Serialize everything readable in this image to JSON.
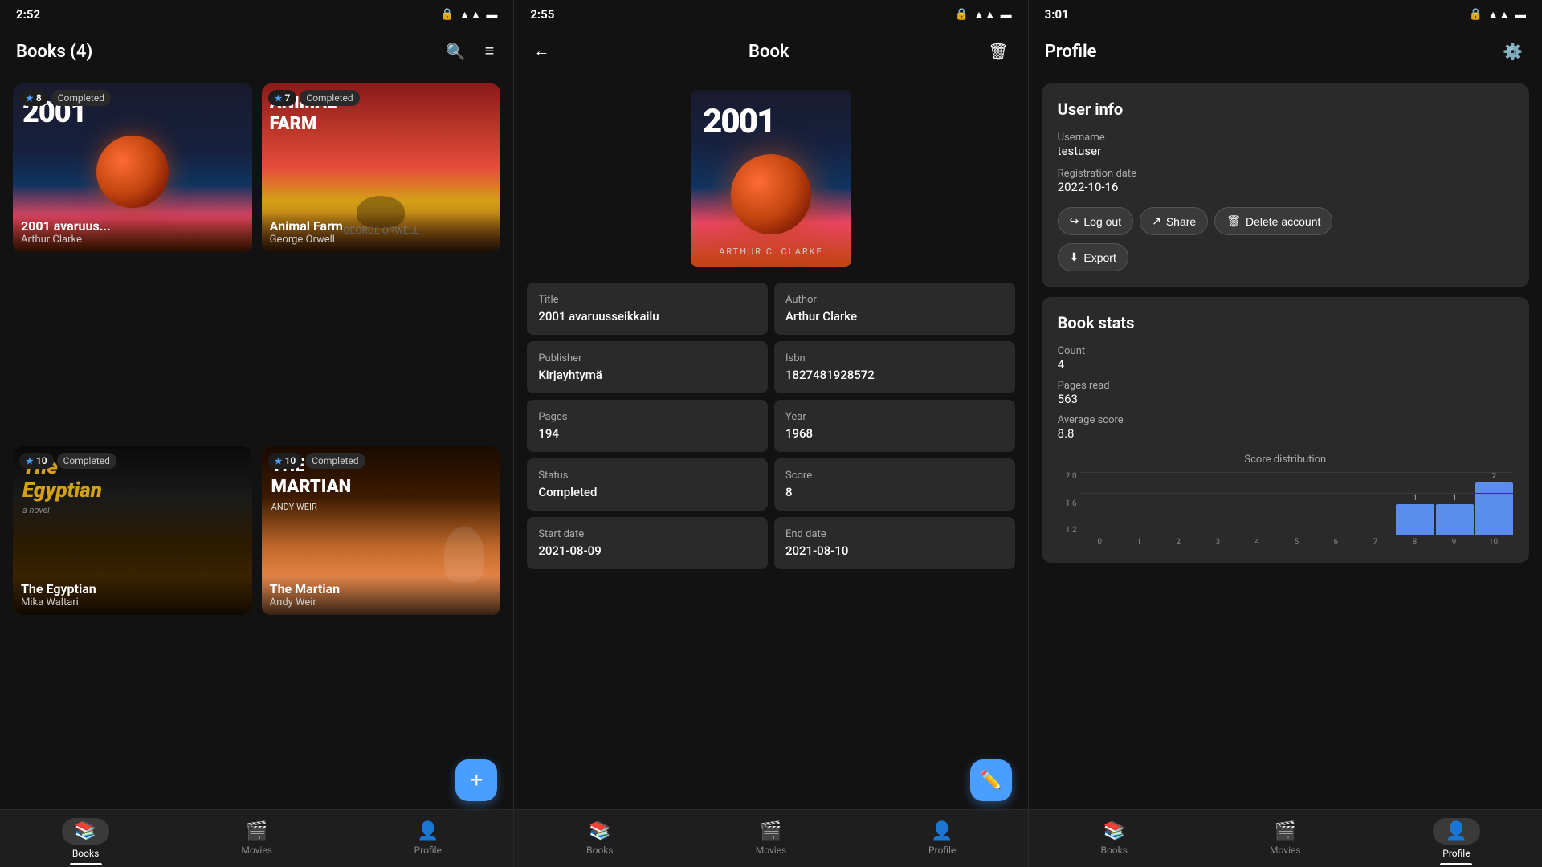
{
  "panels": {
    "books": {
      "status_bar": {
        "time": "2:52",
        "icons": [
          "sim",
          "wifi",
          "battery"
        ]
      },
      "title": "Books (4)",
      "actions": [
        "search",
        "filter"
      ],
      "books": [
        {
          "id": "2001",
          "title": "2001 avaruus...",
          "author": "Arthur Clarke",
          "rating": "8",
          "status": "Completed",
          "cover_type": "2001"
        },
        {
          "id": "animal-farm",
          "title": "Animal Farm",
          "author": "George Orwell",
          "rating": "7",
          "status": "Completed",
          "cover_type": "animal"
        },
        {
          "id": "egyptian",
          "title": "The Egyptian",
          "author": "Mika Waltari",
          "rating": "10",
          "status": "Completed",
          "cover_type": "egyptian"
        },
        {
          "id": "martian",
          "title": "The Martian",
          "author": "Andy Weir",
          "rating": "10",
          "status": "Completed",
          "cover_type": "martian"
        }
      ],
      "nav": {
        "items": [
          {
            "label": "Books",
            "icon": "📚",
            "active": true
          },
          {
            "label": "Movies",
            "icon": "🎬",
            "active": false
          },
          {
            "label": "Profile",
            "icon": "👤",
            "active": false
          }
        ]
      },
      "fab_label": "+"
    },
    "book_detail": {
      "status_bar": {
        "time": "2:55"
      },
      "title": "Book",
      "fields": [
        {
          "label": "Title",
          "value": "2001 avaruusseikkailu"
        },
        {
          "label": "Author",
          "value": "Arthur Clarke"
        },
        {
          "label": "Publisher",
          "value": "Kirjayhtymä"
        },
        {
          "label": "Isbn",
          "value": "1827481928572"
        },
        {
          "label": "Pages",
          "value": "194"
        },
        {
          "label": "Year",
          "value": "1968"
        },
        {
          "label": "Status",
          "value": "Completed"
        },
        {
          "label": "Score",
          "value": "8"
        },
        {
          "label": "Start date",
          "value": "2021-08-09"
        },
        {
          "label": "End date",
          "value": "2021-08-10"
        }
      ],
      "nav": {
        "items": [
          {
            "label": "Books",
            "icon": "📚",
            "active": false
          },
          {
            "label": "Movies",
            "icon": "🎬",
            "active": false
          },
          {
            "label": "Profile",
            "icon": "👤",
            "active": false
          }
        ]
      }
    },
    "profile": {
      "status_bar": {
        "time": "3:01"
      },
      "title": "Profile",
      "user_info": {
        "section_title": "User info",
        "username_label": "Username",
        "username_value": "testuser",
        "reg_date_label": "Registration date",
        "reg_date_value": "2022-10-16"
      },
      "actions": [
        {
          "label": "Log out",
          "icon": "→"
        },
        {
          "label": "Share",
          "icon": "↗"
        },
        {
          "label": "Delete account",
          "icon": "🗑"
        }
      ],
      "export_btn": "Export",
      "book_stats": {
        "section_title": "Book stats",
        "count_label": "Count",
        "count_value": "4",
        "pages_label": "Pages read",
        "pages_value": "563",
        "avg_label": "Average score",
        "avg_value": "8.8",
        "chart_title": "Score distribution",
        "chart_x_labels": [
          "0",
          "1",
          "2",
          "3",
          "4",
          "5",
          "6",
          "7",
          "8",
          "9",
          "10"
        ],
        "chart_y_labels": [
          "2.0",
          "1.6",
          "1.2"
        ],
        "chart_bars": [
          0,
          0,
          0,
          0,
          0,
          0,
          0,
          0,
          1,
          1,
          2
        ],
        "chart_bar_labels": [
          "",
          "",
          "",
          "",
          "",
          "",
          "",
          "",
          "1",
          "1",
          "2"
        ]
      },
      "nav": {
        "items": [
          {
            "label": "Books",
            "icon": "📚",
            "active": false
          },
          {
            "label": "Movies",
            "icon": "🎬",
            "active": false
          },
          {
            "label": "Profile",
            "icon": "👤",
            "active": true
          }
        ]
      }
    }
  }
}
